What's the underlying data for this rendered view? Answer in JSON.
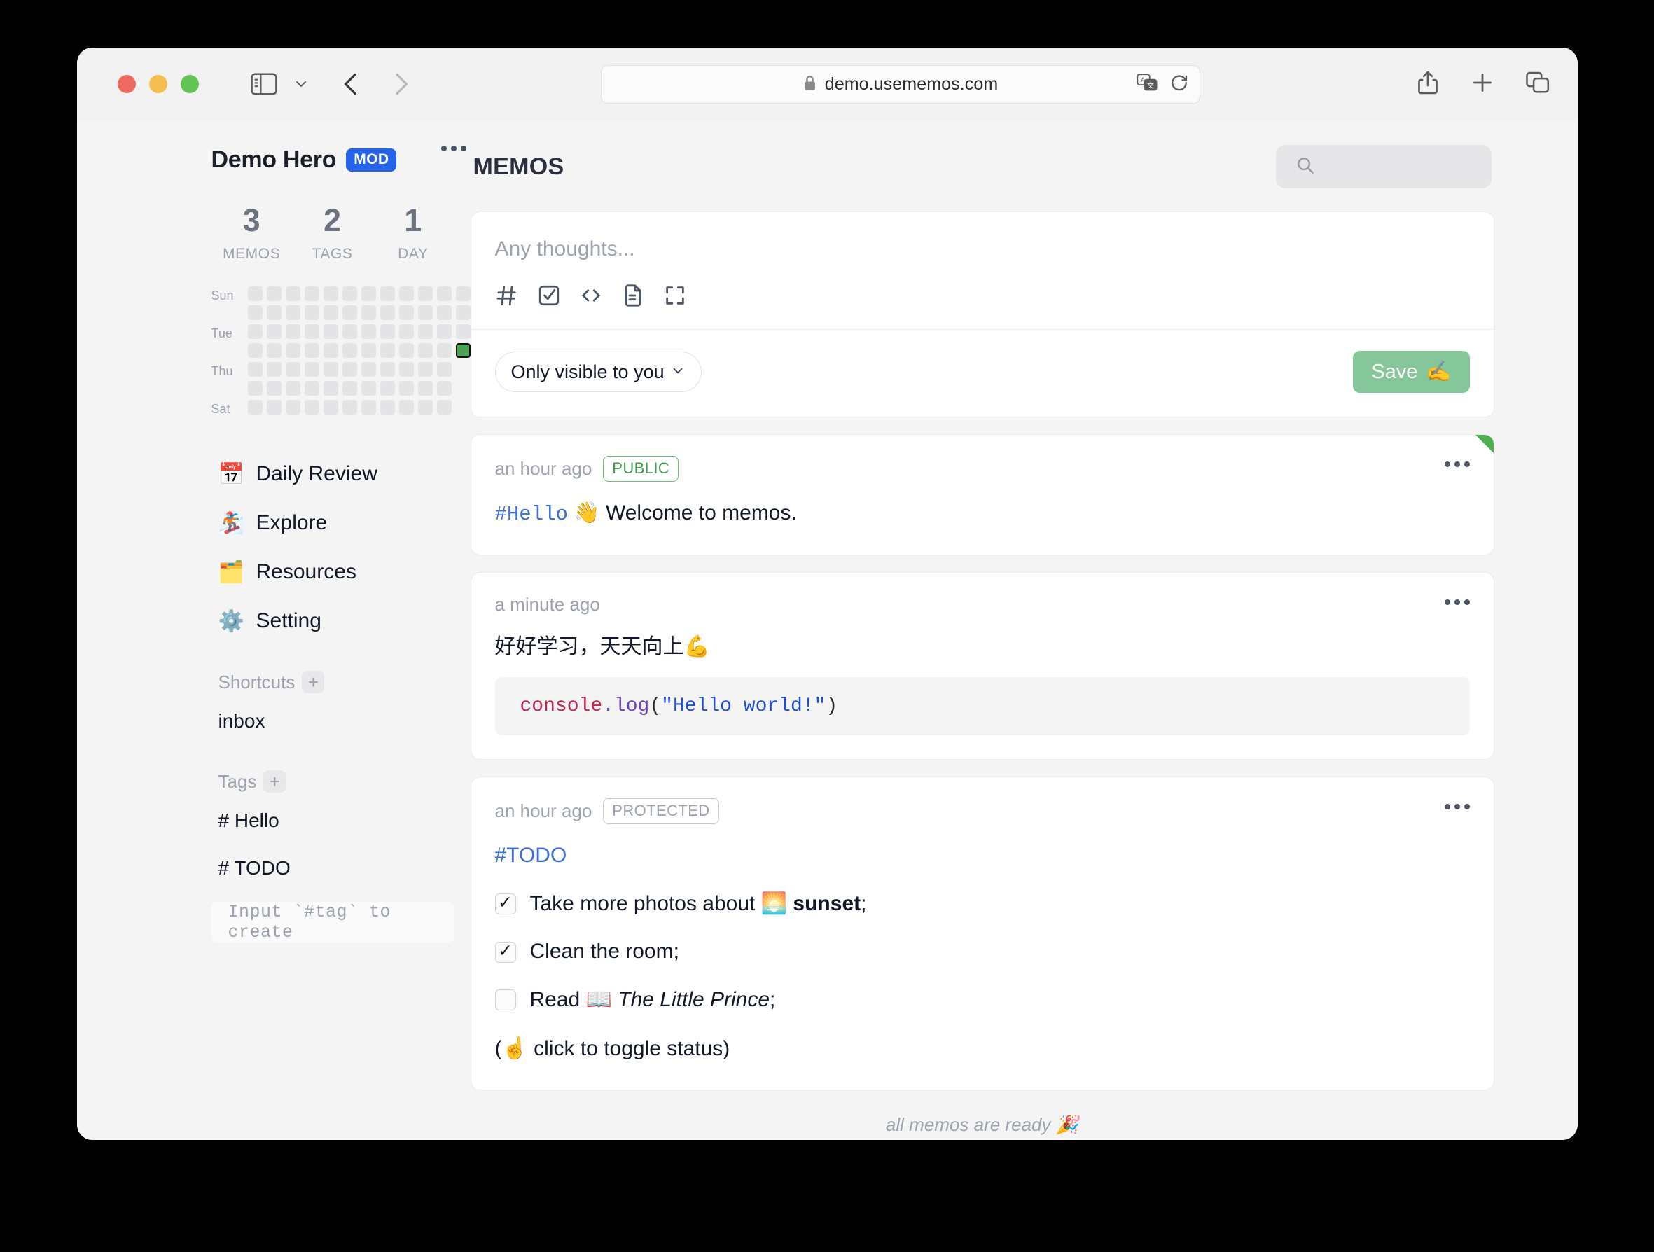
{
  "browser": {
    "url": "demo.usememos.com",
    "lock_icon": "lock-icon",
    "translate_icon": "translate-icon",
    "reload_icon": "reload-icon",
    "sidebar_icon": "sidebar-toggle-icon",
    "back_icon": "back-chevron-icon",
    "forward_icon": "forward-chevron-icon",
    "share_icon": "share-icon",
    "new_tab_icon": "plus-icon",
    "tabs_icon": "tab-overview-icon"
  },
  "sidebar": {
    "user_name": "Demo Hero",
    "user_badge": "MOD",
    "more_icon": "ellipsis-icon",
    "stats": [
      {
        "num": "3",
        "label": "MEMOS"
      },
      {
        "num": "2",
        "label": "TAGS"
      },
      {
        "num": "1",
        "label": "DAY"
      }
    ],
    "heatmap": {
      "day_labels": [
        "Sun",
        "",
        "Tue",
        "",
        "Thu",
        "",
        "Sat"
      ],
      "columns": 12,
      "rows": 7,
      "last_column_rows": 4,
      "active_cell": {
        "column": 11,
        "row": 3
      },
      "empty_color": "#e4e4e7",
      "active_color": "#4ca154"
    },
    "nav": [
      {
        "emoji": "📅",
        "label": "Daily Review",
        "icon": "calendar-icon"
      },
      {
        "emoji": "🏂",
        "label": "Explore",
        "icon": "snowboarder-icon"
      },
      {
        "emoji": "🗂️",
        "label": "Resources",
        "icon": "card-index-dividers-icon"
      },
      {
        "emoji": "⚙️",
        "label": "Setting",
        "icon": "gear-icon"
      }
    ],
    "shortcuts": {
      "title": "Shortcuts",
      "add_label": "+",
      "items": [
        "inbox"
      ]
    },
    "tags": {
      "title": "Tags",
      "add_label": "+",
      "items": [
        "# Hello",
        "# TODO"
      ],
      "input_placeholder": "Input `#tag` to create"
    }
  },
  "main": {
    "title": "MEMOS",
    "search": {
      "icon": "search-icon",
      "placeholder": ""
    },
    "editor": {
      "placeholder": "Any thoughts...",
      "tools": [
        {
          "icon": "hash-icon",
          "glyph": "#"
        },
        {
          "icon": "checkbox-icon",
          "glyph": "☑"
        },
        {
          "icon": "code-icon",
          "glyph": "<>"
        },
        {
          "icon": "document-icon",
          "glyph": "🗋"
        },
        {
          "icon": "fullscreen-icon",
          "glyph": "⛶"
        }
      ],
      "visibility": "Only visible to you",
      "visibility_chevron": "chevron-down-icon",
      "save_label": "Save",
      "save_emoji": "✍️",
      "save_color": "#85c79b"
    },
    "memos": [
      {
        "time": "an hour ago",
        "visibility": "PUBLIC",
        "visibility_style": "public",
        "pinned": true,
        "more_icon": "ellipsis-icon",
        "tag": "#Hello",
        "emoji": "👋",
        "text": "Welcome to memos."
      },
      {
        "time": "a minute ago",
        "visibility": "",
        "visibility_style": "",
        "pinned": false,
        "more_icon": "ellipsis-icon",
        "text": "好好学习，天天向上💪",
        "code": {
          "object": "console",
          "dot_method": ".log",
          "open_paren": "(",
          "string": "\"Hello world!\"",
          "close_paren": ")"
        }
      },
      {
        "time": "an hour ago",
        "visibility": "PROTECTED",
        "visibility_style": "protected",
        "pinned": false,
        "more_icon": "ellipsis-icon",
        "tag": "#TODO",
        "todos": [
          {
            "checked": true,
            "prefix": "Take more photos about ",
            "emoji": "🌅",
            "bold": "sunset",
            "suffix": ";"
          },
          {
            "checked": true,
            "prefix": "Clean the room;",
            "emoji": "",
            "bold": "",
            "suffix": ""
          },
          {
            "checked": false,
            "prefix": "Read ",
            "emoji": "📖",
            "italic": "The Little Prince",
            "suffix": ";"
          }
        ],
        "note": "(☝️ click to toggle status)"
      }
    ],
    "footer": "all memos are ready 🎉"
  }
}
